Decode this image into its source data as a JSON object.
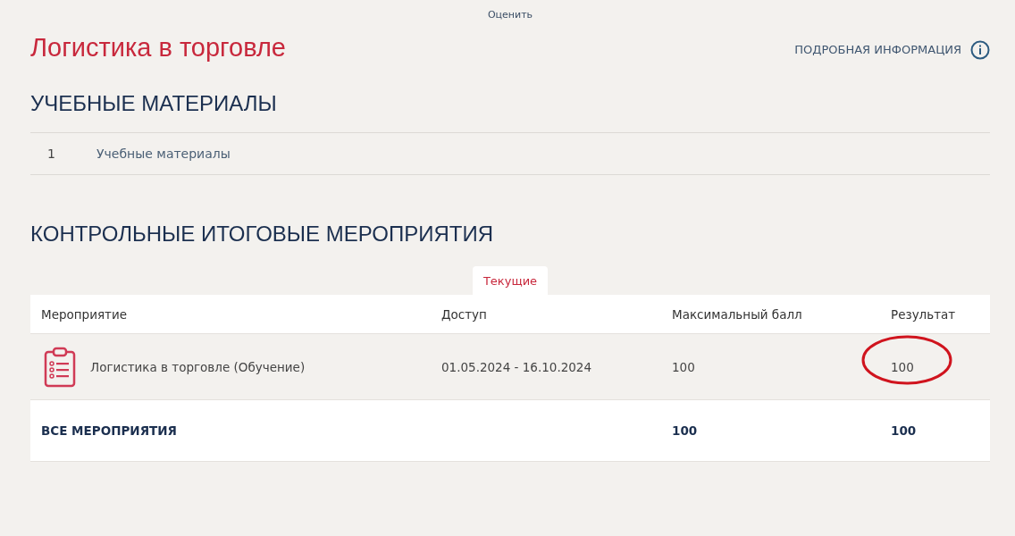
{
  "top_link": "Оценить",
  "course_title": "Логистика в торговле",
  "info_link": "ПОДРОБНАЯ ИНФОРМАЦИЯ",
  "materials": {
    "heading": "УЧЕБНЫЕ МАТЕРИАЛЫ",
    "items": [
      {
        "number": "1",
        "title": "Учебные материалы"
      }
    ]
  },
  "events": {
    "heading": "КОНТРОЛЬНЫЕ ИТОГОВЫЕ МЕРОПРИЯТИЯ",
    "tabs": [
      {
        "label": "Текущие",
        "selected": true
      }
    ],
    "columns": [
      "Мероприятие",
      "Доступ",
      "Максимальный балл",
      "Результат"
    ],
    "rows": [
      {
        "name": "Логистика в торговле (Обучение)",
        "access": "01.05.2024 - 16.10.2024",
        "max_score": "100",
        "result": "100",
        "result_circled": true
      }
    ],
    "total": {
      "label": "ВСЕ МЕРОПРИЯТИЯ",
      "max_score": "100",
      "result": "100"
    }
  }
}
